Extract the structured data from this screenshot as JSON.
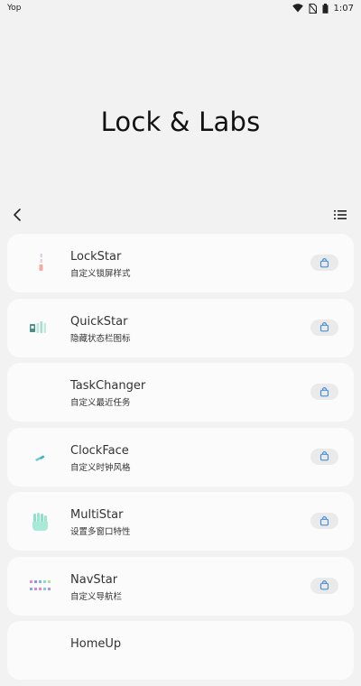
{
  "status": {
    "left_text": "Yop",
    "time": "1:07"
  },
  "hero": {
    "title": "Lock & Labs"
  },
  "items": [
    {
      "title": "LockStar",
      "subtitle": "自定义锁屏样式",
      "icon": "lockstar-icon"
    },
    {
      "title": "QuickStar",
      "subtitle": "隐藏状态栏图标",
      "icon": "quickstar-icon"
    },
    {
      "title": "TaskChanger",
      "subtitle": "自定义最近任务",
      "icon": "taskchanger-icon"
    },
    {
      "title": "ClockFace",
      "subtitle": "自定义时钟风格",
      "icon": "clockface-icon"
    },
    {
      "title": "MultiStar",
      "subtitle": "设置多窗口特性",
      "icon": "multistar-icon"
    },
    {
      "title": "NavStar",
      "subtitle": "自定义导航栏",
      "icon": "navstar-icon"
    },
    {
      "title": "HomeUp",
      "subtitle": "",
      "icon": "homeup-icon"
    }
  ],
  "colors": {
    "accent": "#4a8fd6",
    "background": "#f2f2f2",
    "card": "#fbfbfb"
  }
}
